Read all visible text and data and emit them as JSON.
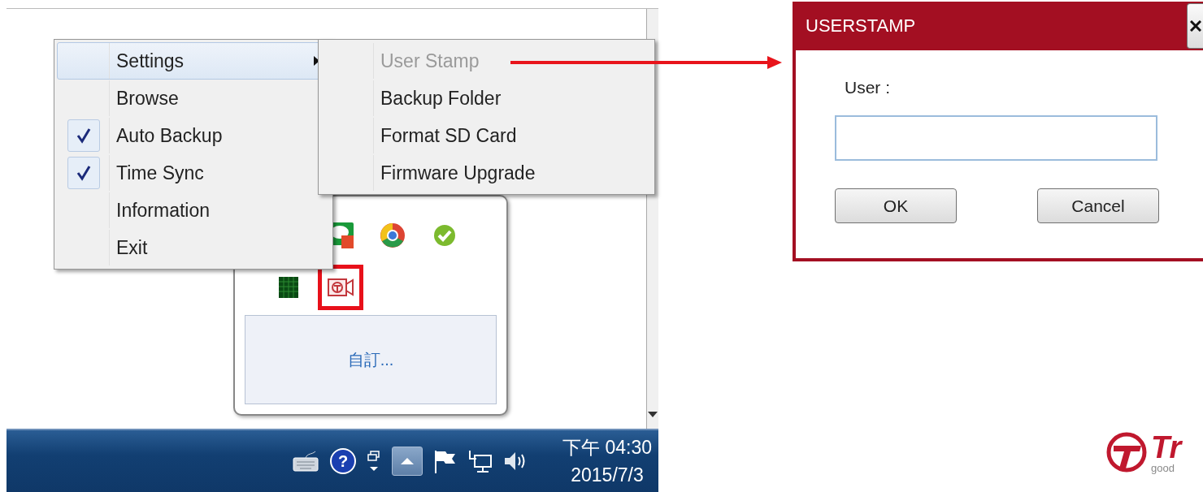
{
  "tray_screenshot": {
    "context_menu": {
      "items": [
        {
          "label": "Settings",
          "selected": true,
          "checked": false,
          "has_submenu": true
        },
        {
          "label": "Browse",
          "selected": false,
          "checked": false,
          "has_submenu": false
        },
        {
          "label": "Auto Backup",
          "selected": false,
          "checked": true,
          "has_submenu": false
        },
        {
          "label": "Time Sync",
          "selected": false,
          "checked": true,
          "has_submenu": false
        },
        {
          "label": "Information",
          "selected": false,
          "checked": false,
          "has_submenu": false
        },
        {
          "label": "Exit",
          "selected": false,
          "checked": false,
          "has_submenu": false
        }
      ]
    },
    "submenu": {
      "items": [
        {
          "label": "User Stamp",
          "disabled": true
        },
        {
          "label": "Backup Folder",
          "disabled": false
        },
        {
          "label": "Format SD Card",
          "disabled": false
        },
        {
          "label": "Firmware Upgrade",
          "disabled": false
        }
      ]
    },
    "tray_popup": {
      "customize_link": "自訂..."
    },
    "taskbar": {
      "help_glyph": "?",
      "time": "下午 04:30",
      "date": "2015/7/3"
    }
  },
  "dialog": {
    "title": "USERSTAMP",
    "field_label": "User :",
    "buttons": [
      "OK",
      "Cancel"
    ]
  },
  "logo": {
    "text": "Tr",
    "tagline": "good"
  }
}
